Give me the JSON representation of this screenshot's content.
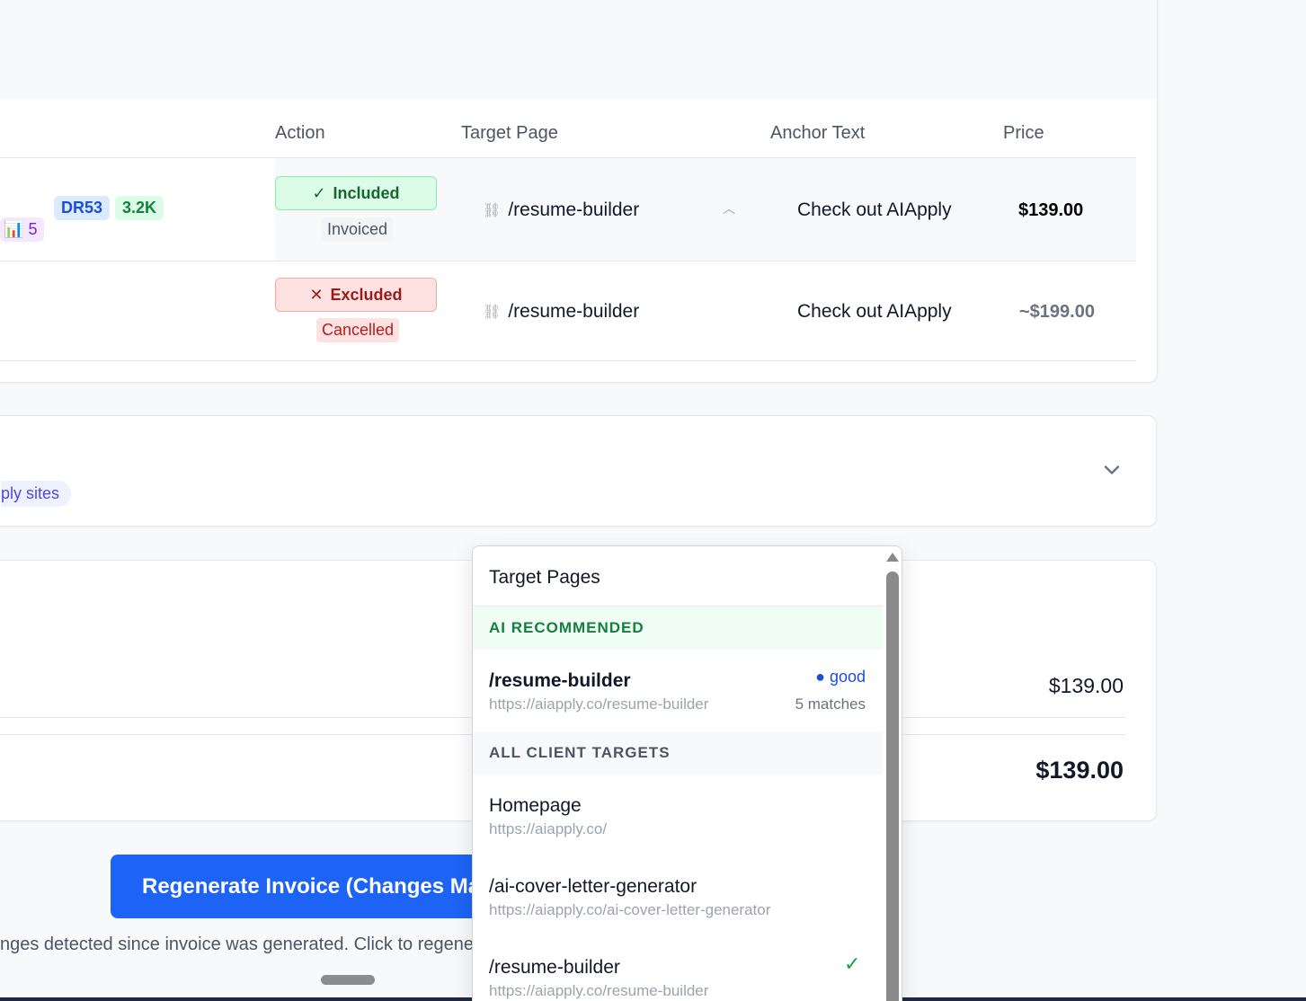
{
  "table": {
    "headers": {
      "action": "Action",
      "target_page": "Target Page",
      "anchor_text": "Anchor Text",
      "price": "Price"
    },
    "rows": [
      {
        "dr": "DR53",
        "traffic": "3.2K",
        "count": "5",
        "action": "Included",
        "status": "Invoiced",
        "target": "/resume-builder",
        "anchor": "Check out AIApply",
        "price": "$139.00"
      },
      {
        "action": "Excluded",
        "status": "Cancelled",
        "target": "/resume-builder",
        "anchor": "Check out AIApply",
        "price": "~$199.00"
      }
    ]
  },
  "sites_card": {
    "chip": "ply sites"
  },
  "summary": {
    "subtotal": "$139.00",
    "total": "$139.00"
  },
  "regenerate": {
    "button_label": "Regenerate Invoice (Changes Made)",
    "note": "nges detected since invoice was generated. Click to regenerate."
  },
  "dropdown": {
    "title": "Target Pages",
    "ai_section": "AI RECOMMENDED",
    "ai_option": {
      "name": "/resume-builder",
      "url": "https://aiapply.co/resume-builder",
      "quality": "● good",
      "matches": "5 matches"
    },
    "all_section": "ALL CLIENT TARGETS",
    "options": [
      {
        "name": "Homepage",
        "url": "https://aiapply.co/"
      },
      {
        "name": "/ai-cover-letter-generator",
        "url": "https://aiapply.co/ai-cover-letter-generator"
      },
      {
        "name": "/resume-builder",
        "url": "https://aiapply.co/resume-builder"
      }
    ]
  },
  "colors": {
    "primary": "#1d63f5",
    "included": "#166534",
    "excluded": "#991b1b"
  }
}
